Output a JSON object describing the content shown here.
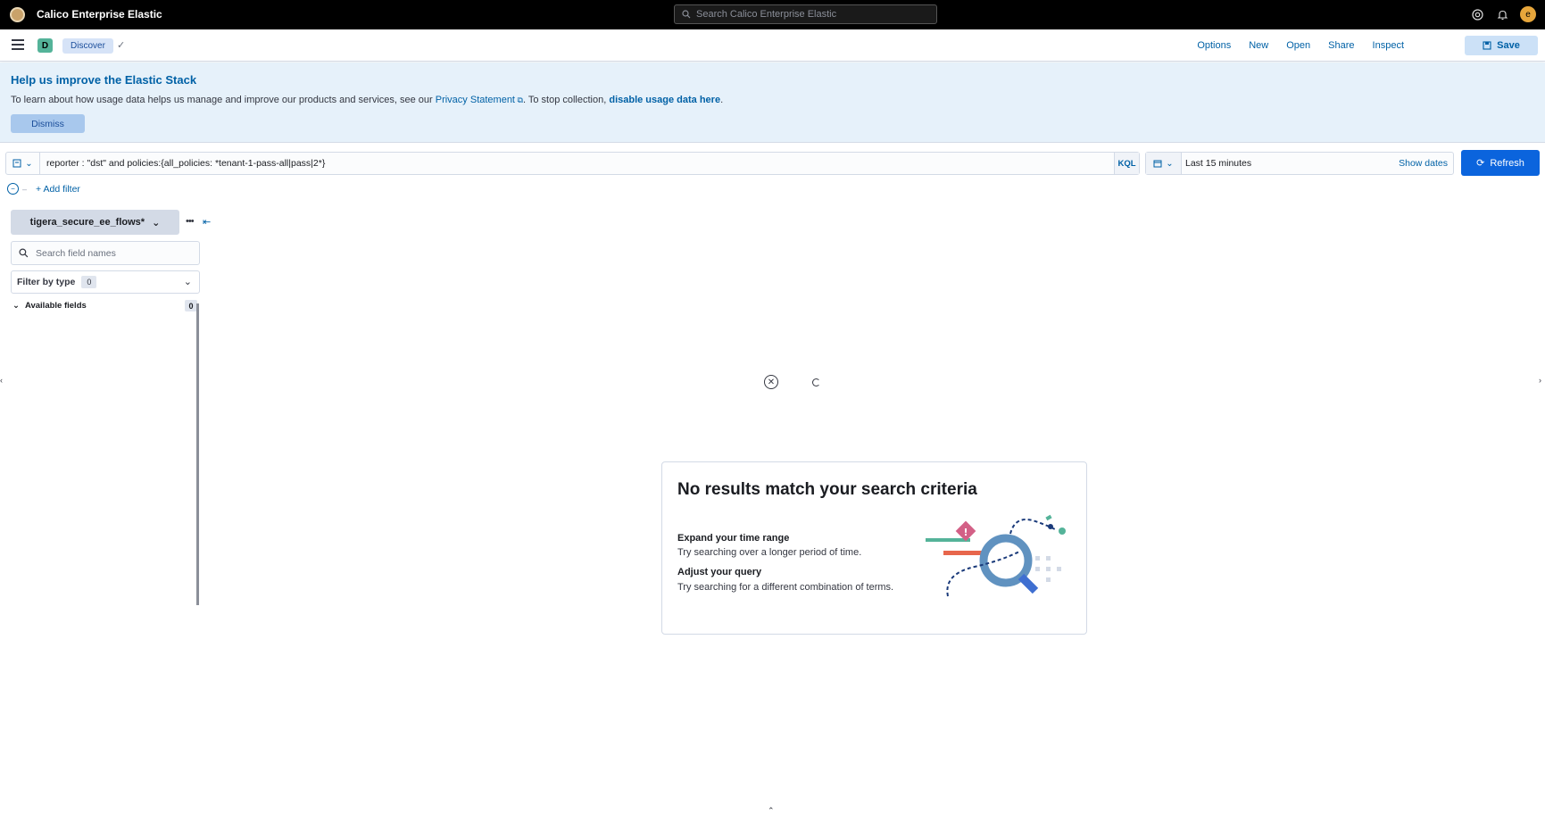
{
  "header": {
    "app_title": "Calico Enterprise Elastic",
    "search_placeholder": "Search Calico Enterprise Elastic",
    "avatar_letter": "e"
  },
  "appbar": {
    "space_letter": "D",
    "breadcrumb": "Discover",
    "menu": [
      "Options",
      "New",
      "Open",
      "Share",
      "Inspect"
    ],
    "save_label": "Save"
  },
  "callout": {
    "title": "Help us improve the Elastic Stack",
    "text_before": "To learn about how usage data helps us manage and improve our products and services, see our ",
    "privacy_link": "Privacy Statement",
    "text_middle": ". To stop collection, ",
    "disable_link": "disable usage data here",
    "text_after": ".",
    "dismiss_label": "Dismiss"
  },
  "query": {
    "text": "reporter : \"dst\" and policies:{all_policies: *tenant-1-pass-all|pass|2*}",
    "language": "KQL",
    "time_range": "Last 15 minutes",
    "show_dates": "Show dates",
    "refresh_label": "Refresh",
    "add_filter": "+ Add filter"
  },
  "sidebar": {
    "index_pattern": "tigera_secure_ee_flows*",
    "field_search_placeholder": "Search field names",
    "filter_by_type": "Filter by type",
    "filter_count": "0",
    "available_fields": "Available fields",
    "available_count": "0"
  },
  "no_results": {
    "title": "No results match your search criteria",
    "tip1_title": "Expand your time range",
    "tip1_text": "Try searching over a longer period of time.",
    "tip2_title": "Adjust your query",
    "tip2_text": "Try searching for a different combination of terms."
  },
  "colors": {
    "accent": "#0061a6",
    "primary_button": "#0b64dd",
    "callout_bg": "#e6f1fa",
    "space_badge": "#54b399"
  }
}
